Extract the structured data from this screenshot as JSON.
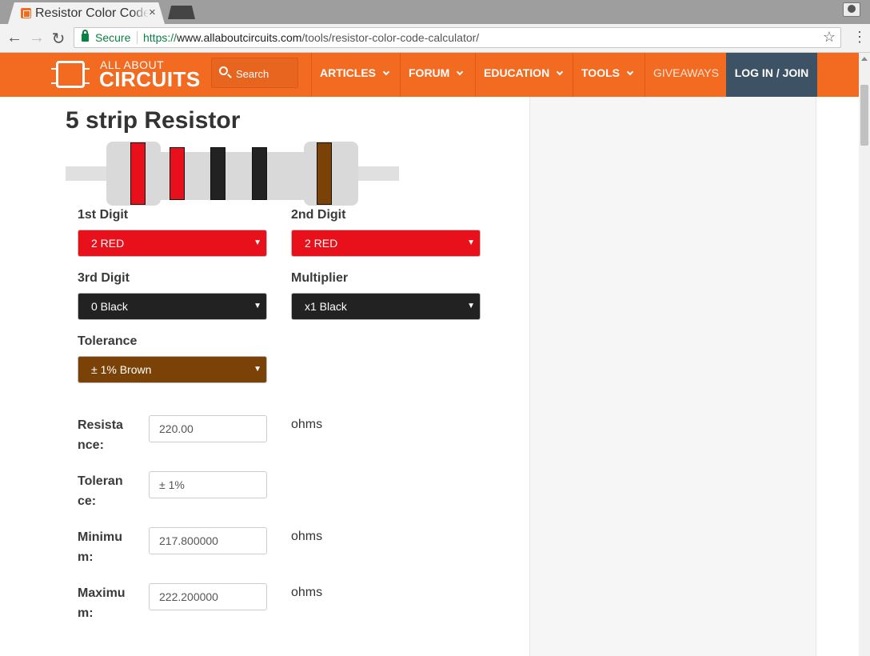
{
  "browser": {
    "tab_title": "Resistor Color Code Calculator",
    "tab_close": "×",
    "back_icon": "←",
    "forward_icon": "→",
    "reload_icon": "↻",
    "secure_label": "Secure",
    "url_scheme": "https://",
    "url_host": "www.allaboutcircuits.com",
    "url_path": "/tools/resistor-color-code-calculator/",
    "star_icon": "☆",
    "menu_icon": "⋮"
  },
  "site": {
    "logo_top": "ALL ABOUT",
    "logo_bottom": "CIRCUITS",
    "search_placeholder": "Search",
    "nav": [
      "ARTICLES",
      "FORUM",
      "EDUCATION",
      "TOOLS",
      "GIVEAWAYS"
    ],
    "login": "LOG IN / JOIN"
  },
  "calculator": {
    "title": "5 strip Resistor",
    "bands": [
      {
        "name": "1st Digit",
        "selected": "2 RED",
        "color": "#e8101a"
      },
      {
        "name": "2nd Digit",
        "selected": "2 RED",
        "color": "#e8101a"
      },
      {
        "name": "3rd Digit",
        "selected": "0 Black",
        "color": "#222222"
      },
      {
        "name": "Multiplier",
        "selected": "x1 Black",
        "color": "#222222"
      },
      {
        "name": "Tolerance",
        "selected": "± 1% Brown",
        "color": "#7b4208"
      }
    ],
    "results": {
      "resistance_label_1": "Resista",
      "resistance_label_2": "nce:",
      "resistance_value": "220.00",
      "resistance_unit": "ohms",
      "tolerance_label_1": "Toleran",
      "tolerance_label_2": "ce:",
      "tolerance_value": "± 1%",
      "minimum_label_1": "Minimu",
      "minimum_label_2": "m:",
      "minimum_value": "217.800000",
      "minimum_unit": "ohms",
      "maximum_label_1": "Maximu",
      "maximum_label_2": "m:",
      "maximum_value": "222.200000",
      "maximum_unit": "ohms"
    }
  }
}
